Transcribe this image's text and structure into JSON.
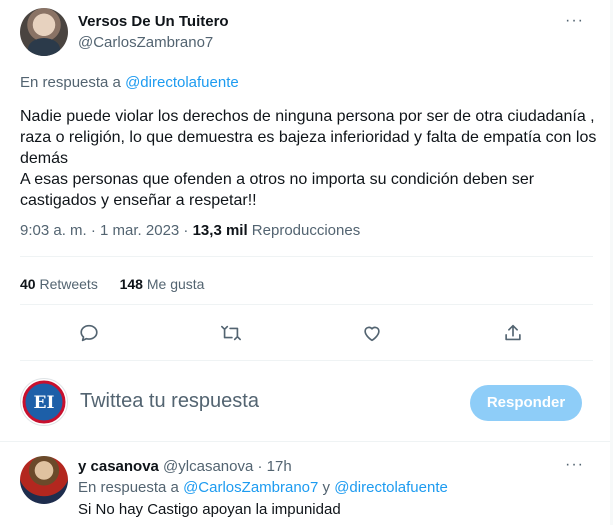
{
  "tweet": {
    "author_name": "Versos De Un Tuitero",
    "author_handle": "@CarlosZambrano7",
    "more": "···",
    "reply_prefix": "En respuesta a ",
    "reply_to": "@directolafuente",
    "text": "Nadie puede violar los derechos de ninguna persona por ser de otra ciudadanía , raza o religión, lo que demuestra es bajeza inferioridad y falta de empatía con los demás\nA esas personas que ofenden a otros no importa su condición deben ser castigados y enseñar a respetar!!",
    "time": "9:03 a. m. · 1 mar. 2023 · ",
    "views": "13,3 mil",
    "views_label": " Reproducciones"
  },
  "stats": {
    "retweets_count": "40",
    "retweets_label": " Retweets",
    "likes_count": "148",
    "likes_label": " Me gusta"
  },
  "actions": {
    "icons": [
      "reply-icon",
      "retweet-icon",
      "like-icon",
      "share-icon"
    ]
  },
  "compose": {
    "avatar_text": "EI",
    "placeholder": "Twittea tu respuesta",
    "button": "Responder"
  },
  "reply": {
    "name": "y casanova",
    "handle": " @ylcasanova · 17h",
    "more": "···",
    "reply_prefix": "En respuesta a ",
    "reply_to_1": "@CarlosZambrano7",
    "reply_and": " y ",
    "reply_to_2": "@directolafuente",
    "text": "Si No hay Castigo apoyan la impunidad"
  },
  "colors": {
    "accent": "#1d9bf0",
    "button_disabled": "#8ecdf8",
    "muted": "#536471",
    "brand_red": "#c8102e",
    "brand_blue": "#1d5fa8"
  }
}
